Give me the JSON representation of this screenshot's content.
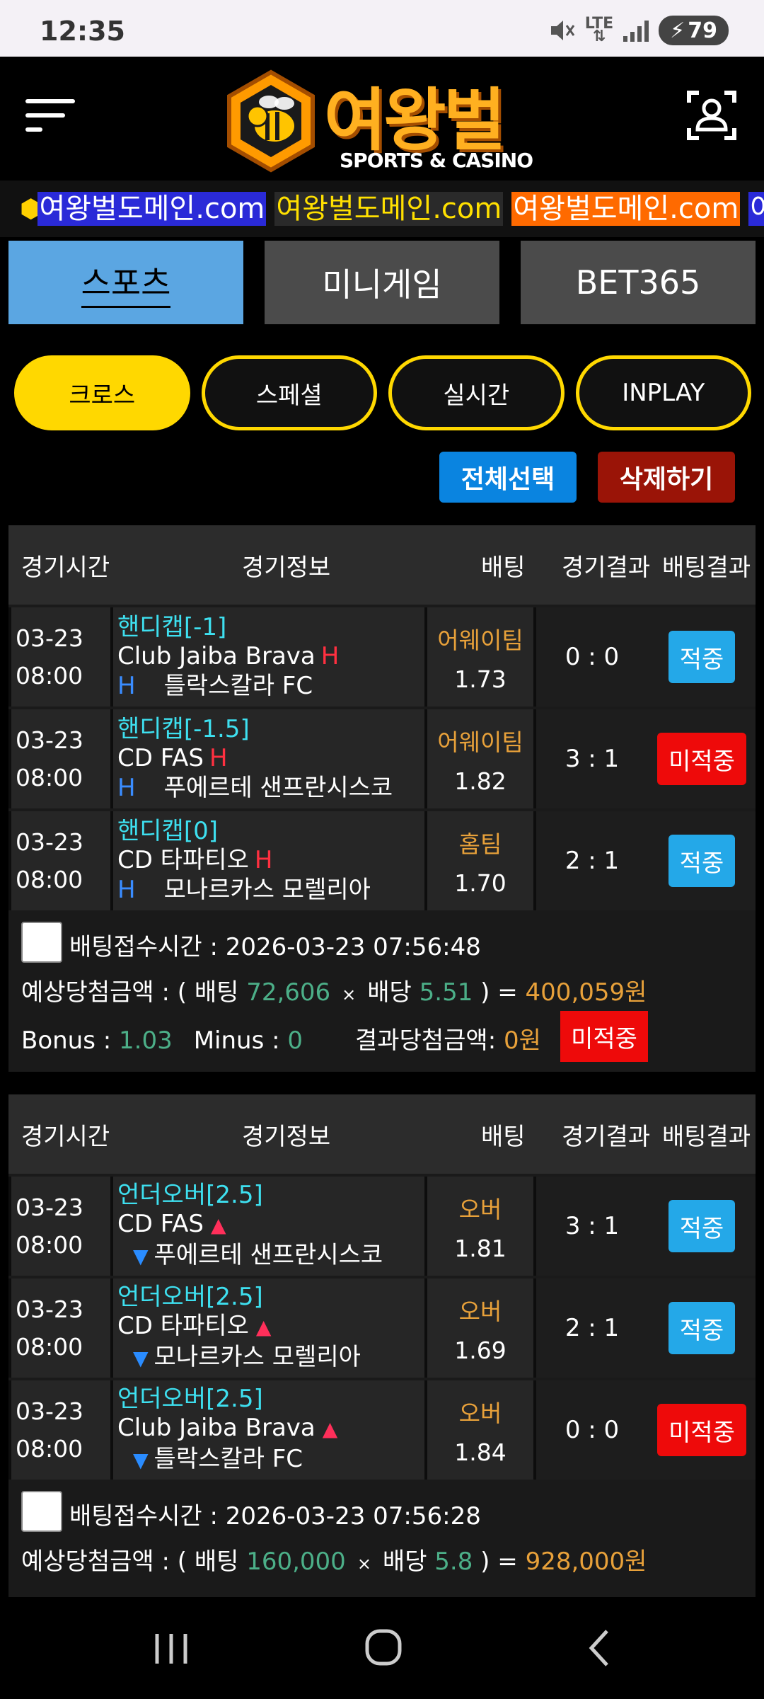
{
  "status": {
    "time": "12:35",
    "network": "LTE",
    "battery": "79"
  },
  "header": {
    "brand": "여왕벌",
    "brand_sub": "SPORTS & CASINO"
  },
  "marquee": {
    "items": [
      {
        "text": "여왕벌도메인.com",
        "bg": "#2a2ad8",
        "fg": "#ffffff"
      },
      {
        "text": "여왕벌도메인.com",
        "bg": "#2a2a2a",
        "fg": "#ffe000"
      },
      {
        "text": "여왕벌도메인.com",
        "bg": "#ff6a00",
        "fg": "#ffffff"
      },
      {
        "text": "여",
        "bg": "#2a2ad8",
        "fg": "#ffffff"
      }
    ]
  },
  "main_tabs": [
    {
      "label": "스포츠",
      "active": true
    },
    {
      "label": "미니게임",
      "active": false
    },
    {
      "label": "BET365",
      "active": false
    }
  ],
  "sub_tabs": [
    {
      "label": "크로스",
      "active": true
    },
    {
      "label": "스페셜",
      "active": false
    },
    {
      "label": "실시간",
      "active": false
    },
    {
      "label": "INPLAY",
      "active": false
    }
  ],
  "actions": {
    "select_all": "전체선택",
    "delete": "삭제하기"
  },
  "columns": {
    "time": "경기시간",
    "info": "경기정보",
    "bet": "배팅",
    "score": "경기결과",
    "result": "배팅결과"
  },
  "slips": [
    {
      "rows": [
        {
          "date": "03-23",
          "time": "08:00",
          "market": "핸디캡[-1]",
          "home": "Club Jaiba Brava",
          "away": "틀락스칼라 FC",
          "type": "handicap",
          "home_mark": "H",
          "away_mark": "H",
          "pick": "어웨이팀",
          "odds": "1.73",
          "score": "0 : 0",
          "result": "적중",
          "result_type": "win"
        },
        {
          "date": "03-23",
          "time": "08:00",
          "market": "핸디캡[-1.5]",
          "home": "CD FAS",
          "away": "푸에르테 샌프란시스코",
          "type": "handicap",
          "home_mark": "H",
          "away_mark": "H",
          "pick": "어웨이팀",
          "odds": "1.82",
          "score": "3 : 1",
          "result": "미적중",
          "result_type": "lose"
        },
        {
          "date": "03-23",
          "time": "08:00",
          "market": "핸디캡[0]",
          "home": "CD 타파티오",
          "away": "모나르카스 모렐리아",
          "type": "handicap",
          "home_mark": "H",
          "away_mark": "H",
          "pick": "홈팀",
          "odds": "1.70",
          "score": "2 : 1",
          "result": "적중",
          "result_type": "win"
        }
      ],
      "received_label": "배팅접수시간 : ",
      "received_time": "2026-03-23 07:56:48",
      "expected_label": "예상당첨금액 : ( 배팅 ",
      "bet_amount": "72,606",
      "times": "×",
      "odds_label": "배당 ",
      "total_odds": "5.51",
      "eq": " ) = ",
      "payout": "400,059원",
      "bonus_label": "Bonus : ",
      "bonus": "1.03",
      "minus_label": "Minus : ",
      "minus": "0",
      "final_label": "결과당첨금액: ",
      "final": "0원",
      "status": "미적중"
    },
    {
      "rows": [
        {
          "date": "03-23",
          "time": "08:00",
          "market": "언더오버[2.5]",
          "home": "CD FAS",
          "away": "푸에르테 샌프란시스코",
          "type": "ou",
          "home_mark": "▲",
          "away_mark": "▼",
          "pick": "오버",
          "odds": "1.81",
          "score": "3 : 1",
          "result": "적중",
          "result_type": "win"
        },
        {
          "date": "03-23",
          "time": "08:00",
          "market": "언더오버[2.5]",
          "home": "CD 타파티오",
          "away": "모나르카스 모렐리아",
          "type": "ou",
          "home_mark": "▲",
          "away_mark": "▼",
          "pick": "오버",
          "odds": "1.69",
          "score": "2 : 1",
          "result": "적중",
          "result_type": "win"
        },
        {
          "date": "03-23",
          "time": "08:00",
          "market": "언더오버[2.5]",
          "home": "Club Jaiba Brava",
          "away": "틀락스칼라 FC",
          "type": "ou",
          "home_mark": "▲",
          "away_mark": "▼",
          "pick": "오버",
          "odds": "1.84",
          "score": "0 : 0",
          "result": "미적중",
          "result_type": "lose"
        }
      ],
      "received_label": "배팅접수시간 : ",
      "received_time": "2026-03-23 07:56:28",
      "expected_label": "예상당첨금액 : ( 배팅 ",
      "bet_amount": "160,000",
      "times": "×",
      "odds_label": "배당 ",
      "total_odds": "5.8",
      "eq": " ) = ",
      "payout": "928,000원"
    }
  ],
  "colors": {
    "accent_yellow": "#ffd800",
    "tab_active": "#5ba6e2",
    "win": "#24a8e8",
    "lose": "#ee0a0a",
    "market": "#3ee0f0",
    "pick": "#e8a13a"
  }
}
